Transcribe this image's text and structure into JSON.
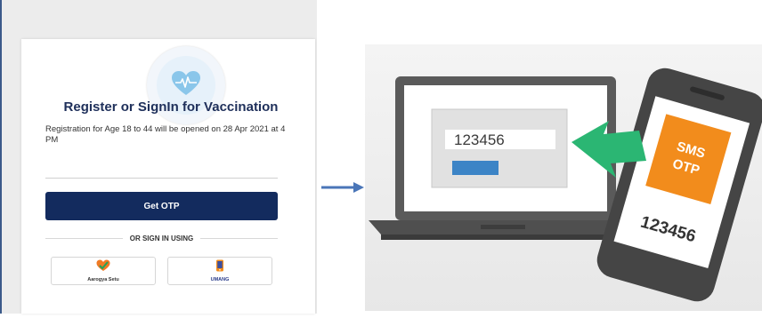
{
  "signin": {
    "title": "Register or SignIn for Vaccination",
    "info": "Registration for Age 18 to 44 will be opened on 28 Apr 2021 at 4 PM",
    "get_otp_label": "Get OTP",
    "or_label": "OR SIGN IN USING",
    "aarogya_label": "Aarogya Setu",
    "umang_label": "UMANG"
  },
  "illustration": {
    "laptop_code": "123456",
    "sms_line1": "SMS",
    "sms_line2": "OTP",
    "phone_code": "123456"
  },
  "colors": {
    "brand_navy": "#132b5e",
    "title_blue": "#1e2f5a",
    "green_arrow": "#2bb673",
    "sms_orange": "#f28c1c",
    "flow_arrow_blue": "#4a76b8"
  },
  "icons": [
    "heart-pulse-icon",
    "aarogya-setu-icon",
    "umang-icon",
    "right-arrow-icon",
    "green-arrow-icon"
  ]
}
